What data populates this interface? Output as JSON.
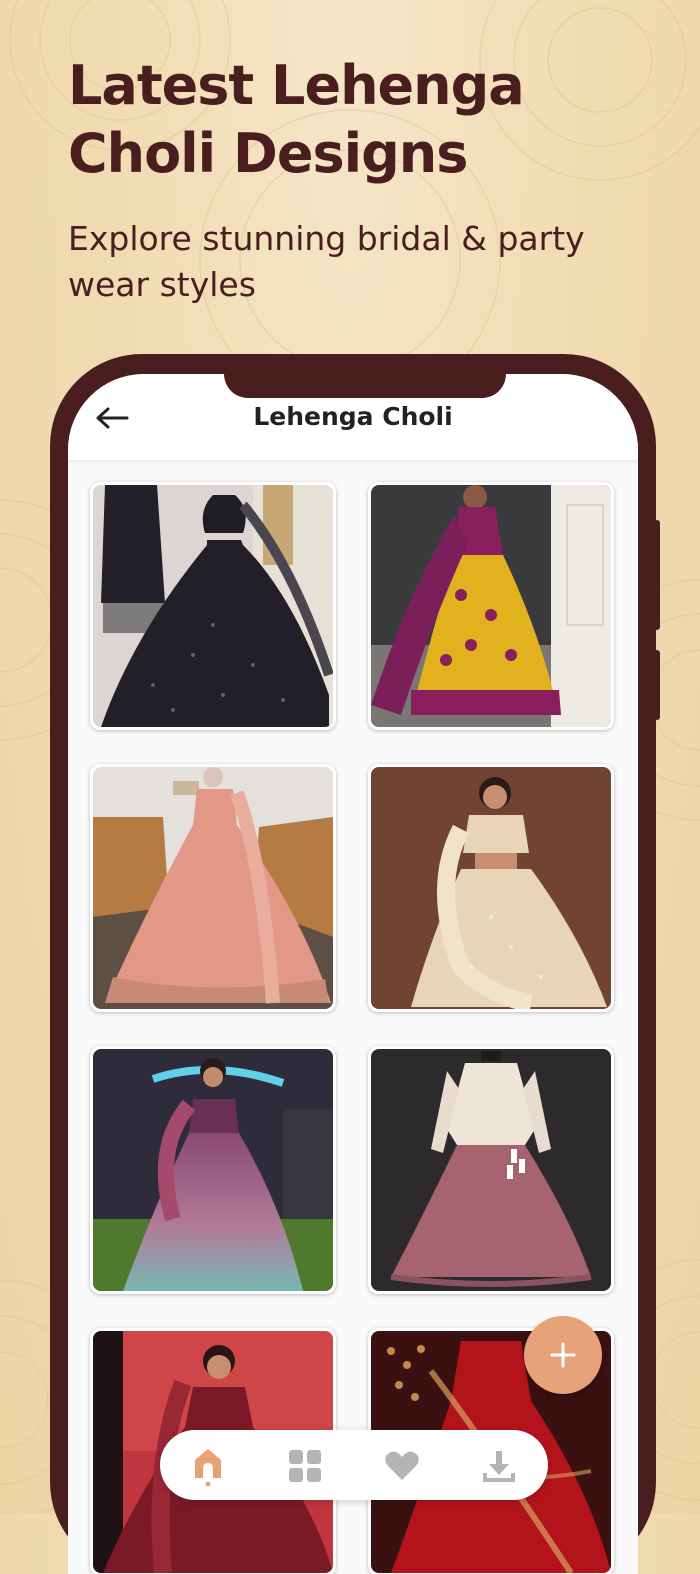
{
  "promo": {
    "headline": "Latest Lehenga Choli Designs",
    "subheadline": "Explore stunning bridal & party wear styles"
  },
  "app": {
    "title": "Lehenga Choli",
    "back_icon": "arrow-left-icon"
  },
  "gallery": {
    "items": [
      {
        "name": "black-sequin-lehenga",
        "palette": [
          "#1d1b22",
          "#2b2732",
          "#c7c4c3"
        ]
      },
      {
        "name": "purple-yellow-patola-lehenga",
        "palette": [
          "#7a1f5a",
          "#e2b21e",
          "#f2efea"
        ]
      },
      {
        "name": "peach-pink-lehenga",
        "palette": [
          "#e39787",
          "#b57b43",
          "#e4e1dd"
        ]
      },
      {
        "name": "ivory-gold-lehenga",
        "palette": [
          "#e8d5b7",
          "#7b4a35",
          "#5e3a2b"
        ]
      },
      {
        "name": "ombre-mauve-teal-lehenga",
        "palette": [
          "#8a4a72",
          "#77b7b3",
          "#2e2b3a"
        ]
      },
      {
        "name": "mauve-peplum-lehenga",
        "palette": [
          "#a56470",
          "#efe5d8",
          "#2c2a2d"
        ]
      },
      {
        "name": "maroon-bridal-lehenga",
        "palette": [
          "#7a1a26",
          "#c1353e",
          "#1f1215"
        ]
      },
      {
        "name": "red-embroidered-bridal-lehenga",
        "palette": [
          "#b3141c",
          "#d9a05c",
          "#3a1010"
        ]
      }
    ]
  },
  "fab": {
    "icon": "plus-icon"
  },
  "bottom_nav": {
    "items": [
      {
        "icon": "home-icon",
        "active": true
      },
      {
        "icon": "grid-icon",
        "active": false
      },
      {
        "icon": "heart-icon",
        "active": false
      },
      {
        "icon": "download-icon",
        "active": false
      }
    ]
  },
  "colors": {
    "brand": "#4a1d1f",
    "background": "#f1dcb3",
    "accent": "#e7a27a",
    "inactive_icon": "#b4b4b4"
  }
}
